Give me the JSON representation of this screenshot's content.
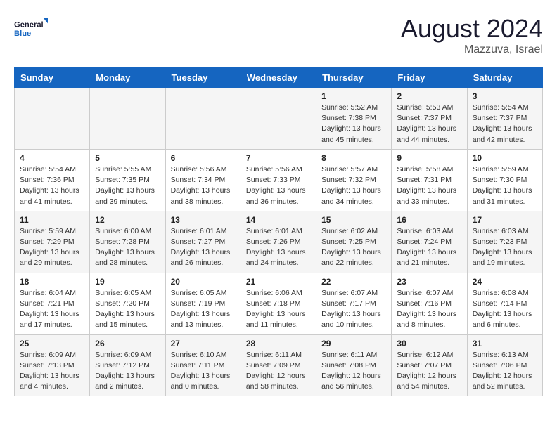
{
  "logo": {
    "line1": "General",
    "line2": "Blue"
  },
  "title": "August 2024",
  "subtitle": "Mazzuva, Israel",
  "days_of_week": [
    "Sunday",
    "Monday",
    "Tuesday",
    "Wednesday",
    "Thursday",
    "Friday",
    "Saturday"
  ],
  "weeks": [
    [
      {
        "num": "",
        "detail": ""
      },
      {
        "num": "",
        "detail": ""
      },
      {
        "num": "",
        "detail": ""
      },
      {
        "num": "",
        "detail": ""
      },
      {
        "num": "1",
        "detail": "Sunrise: 5:52 AM\nSunset: 7:38 PM\nDaylight: 13 hours and 45 minutes."
      },
      {
        "num": "2",
        "detail": "Sunrise: 5:53 AM\nSunset: 7:37 PM\nDaylight: 13 hours and 44 minutes."
      },
      {
        "num": "3",
        "detail": "Sunrise: 5:54 AM\nSunset: 7:37 PM\nDaylight: 13 hours and 42 minutes."
      }
    ],
    [
      {
        "num": "4",
        "detail": "Sunrise: 5:54 AM\nSunset: 7:36 PM\nDaylight: 13 hours and 41 minutes."
      },
      {
        "num": "5",
        "detail": "Sunrise: 5:55 AM\nSunset: 7:35 PM\nDaylight: 13 hours and 39 minutes."
      },
      {
        "num": "6",
        "detail": "Sunrise: 5:56 AM\nSunset: 7:34 PM\nDaylight: 13 hours and 38 minutes."
      },
      {
        "num": "7",
        "detail": "Sunrise: 5:56 AM\nSunset: 7:33 PM\nDaylight: 13 hours and 36 minutes."
      },
      {
        "num": "8",
        "detail": "Sunrise: 5:57 AM\nSunset: 7:32 PM\nDaylight: 13 hours and 34 minutes."
      },
      {
        "num": "9",
        "detail": "Sunrise: 5:58 AM\nSunset: 7:31 PM\nDaylight: 13 hours and 33 minutes."
      },
      {
        "num": "10",
        "detail": "Sunrise: 5:59 AM\nSunset: 7:30 PM\nDaylight: 13 hours and 31 minutes."
      }
    ],
    [
      {
        "num": "11",
        "detail": "Sunrise: 5:59 AM\nSunset: 7:29 PM\nDaylight: 13 hours and 29 minutes."
      },
      {
        "num": "12",
        "detail": "Sunrise: 6:00 AM\nSunset: 7:28 PM\nDaylight: 13 hours and 28 minutes."
      },
      {
        "num": "13",
        "detail": "Sunrise: 6:01 AM\nSunset: 7:27 PM\nDaylight: 13 hours and 26 minutes."
      },
      {
        "num": "14",
        "detail": "Sunrise: 6:01 AM\nSunset: 7:26 PM\nDaylight: 13 hours and 24 minutes."
      },
      {
        "num": "15",
        "detail": "Sunrise: 6:02 AM\nSunset: 7:25 PM\nDaylight: 13 hours and 22 minutes."
      },
      {
        "num": "16",
        "detail": "Sunrise: 6:03 AM\nSunset: 7:24 PM\nDaylight: 13 hours and 21 minutes."
      },
      {
        "num": "17",
        "detail": "Sunrise: 6:03 AM\nSunset: 7:23 PM\nDaylight: 13 hours and 19 minutes."
      }
    ],
    [
      {
        "num": "18",
        "detail": "Sunrise: 6:04 AM\nSunset: 7:21 PM\nDaylight: 13 hours and 17 minutes."
      },
      {
        "num": "19",
        "detail": "Sunrise: 6:05 AM\nSunset: 7:20 PM\nDaylight: 13 hours and 15 minutes."
      },
      {
        "num": "20",
        "detail": "Sunrise: 6:05 AM\nSunset: 7:19 PM\nDaylight: 13 hours and 13 minutes."
      },
      {
        "num": "21",
        "detail": "Sunrise: 6:06 AM\nSunset: 7:18 PM\nDaylight: 13 hours and 11 minutes."
      },
      {
        "num": "22",
        "detail": "Sunrise: 6:07 AM\nSunset: 7:17 PM\nDaylight: 13 hours and 10 minutes."
      },
      {
        "num": "23",
        "detail": "Sunrise: 6:07 AM\nSunset: 7:16 PM\nDaylight: 13 hours and 8 minutes."
      },
      {
        "num": "24",
        "detail": "Sunrise: 6:08 AM\nSunset: 7:14 PM\nDaylight: 13 hours and 6 minutes."
      }
    ],
    [
      {
        "num": "25",
        "detail": "Sunrise: 6:09 AM\nSunset: 7:13 PM\nDaylight: 13 hours and 4 minutes."
      },
      {
        "num": "26",
        "detail": "Sunrise: 6:09 AM\nSunset: 7:12 PM\nDaylight: 13 hours and 2 minutes."
      },
      {
        "num": "27",
        "detail": "Sunrise: 6:10 AM\nSunset: 7:11 PM\nDaylight: 13 hours and 0 minutes."
      },
      {
        "num": "28",
        "detail": "Sunrise: 6:11 AM\nSunset: 7:09 PM\nDaylight: 12 hours and 58 minutes."
      },
      {
        "num": "29",
        "detail": "Sunrise: 6:11 AM\nSunset: 7:08 PM\nDaylight: 12 hours and 56 minutes."
      },
      {
        "num": "30",
        "detail": "Sunrise: 6:12 AM\nSunset: 7:07 PM\nDaylight: 12 hours and 54 minutes."
      },
      {
        "num": "31",
        "detail": "Sunrise: 6:13 AM\nSunset: 7:06 PM\nDaylight: 12 hours and 52 minutes."
      }
    ]
  ]
}
